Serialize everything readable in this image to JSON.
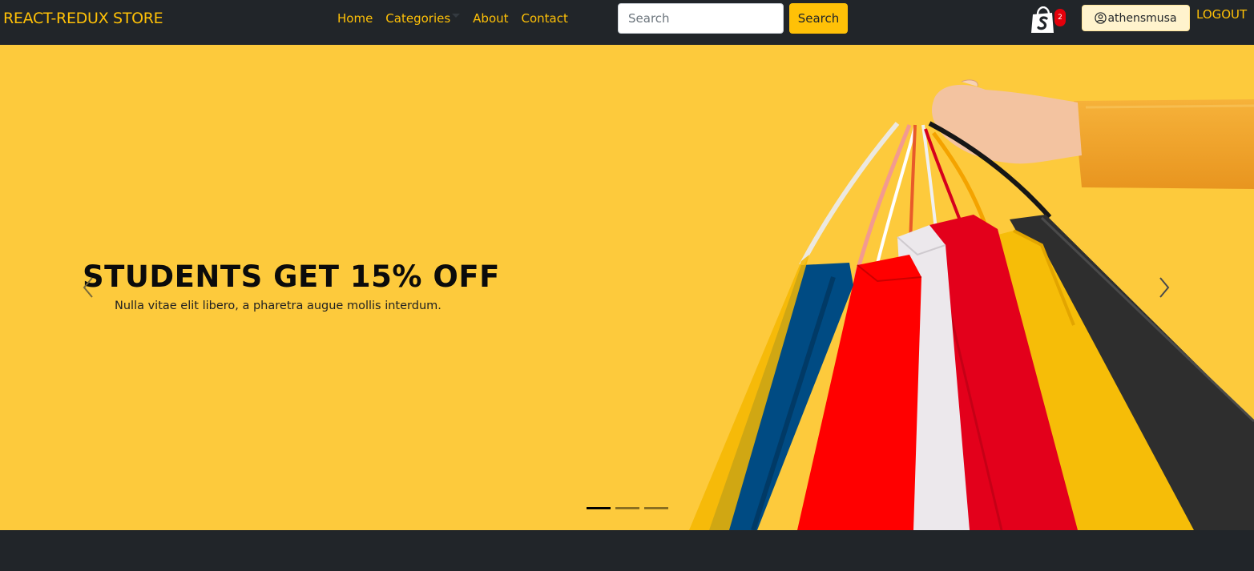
{
  "colors": {
    "navbar_bg": "#212529",
    "accent": "#ffc107",
    "hero_bg": "#fdca3c",
    "badge_red": "#e3000b"
  },
  "navbar": {
    "brand": "REACT-REDUX STORE",
    "links": [
      {
        "label": "Home"
      },
      {
        "label": "Categories",
        "dropdown": true
      },
      {
        "label": "About"
      },
      {
        "label": "Contact"
      }
    ],
    "search": {
      "placeholder": "Search",
      "value": "",
      "button_label": "Search"
    },
    "cart": {
      "icon": "shopify-bag-icon",
      "count": "2"
    },
    "user": {
      "icon": "user-circle-icon",
      "username": "athensmusa"
    },
    "logout_label": "LOGOUT"
  },
  "carousel": {
    "slide": {
      "title": "STUDENTS GET 15% OFF",
      "text": "Nulla vitae elit libero, a pharetra augue mollis interdum."
    },
    "prev_icon": "chevron-left-icon",
    "next_icon": "chevron-right-icon",
    "slide_count": 3,
    "active_index": 0
  }
}
